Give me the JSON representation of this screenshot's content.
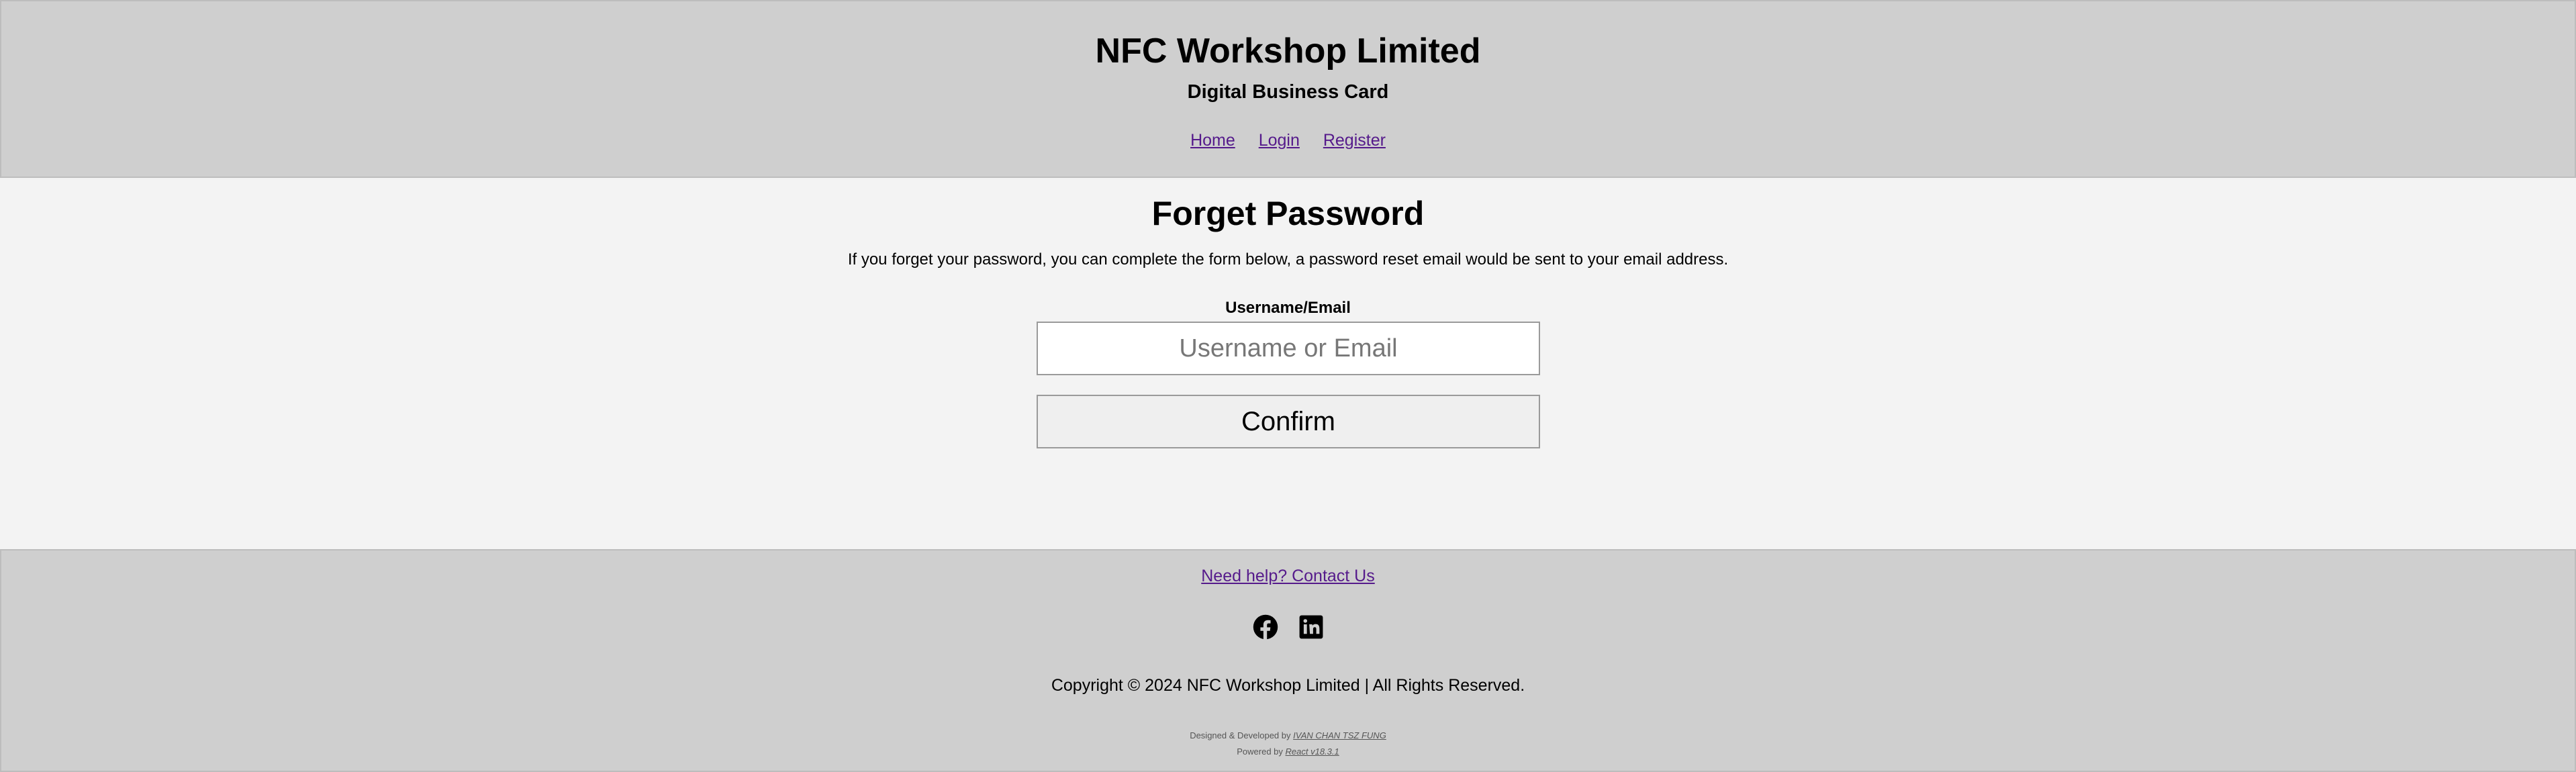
{
  "header": {
    "title": "NFC Workshop Limited",
    "subtitle": "Digital Business Card",
    "nav": [
      "Home",
      "Login",
      "Register"
    ]
  },
  "main": {
    "title": "Forget Password",
    "description": "If you forget your password, you can complete the form below, a password reset email would be sent to your email address.",
    "field_label": "Username/Email",
    "field_placeholder": "Username or Email",
    "field_value": "",
    "confirm_label": "Confirm"
  },
  "footer": {
    "contact_link": "Need help? Contact Us",
    "socials": [
      "facebook-icon",
      "linkedin-icon"
    ],
    "copyright": "Copyright © 2024 NFC Workshop Limited | All Rights Reserved.",
    "designed_prefix": "Designed & Developed by ",
    "designer": "IVAN CHAN TSZ FUNG",
    "powered_prefix": "Powered by ",
    "powered_by": "React v18.3.1"
  },
  "colors": {
    "header_bg": "#cfcfcf",
    "page_bg": "#f3f3f3",
    "link": "#551a8b"
  }
}
